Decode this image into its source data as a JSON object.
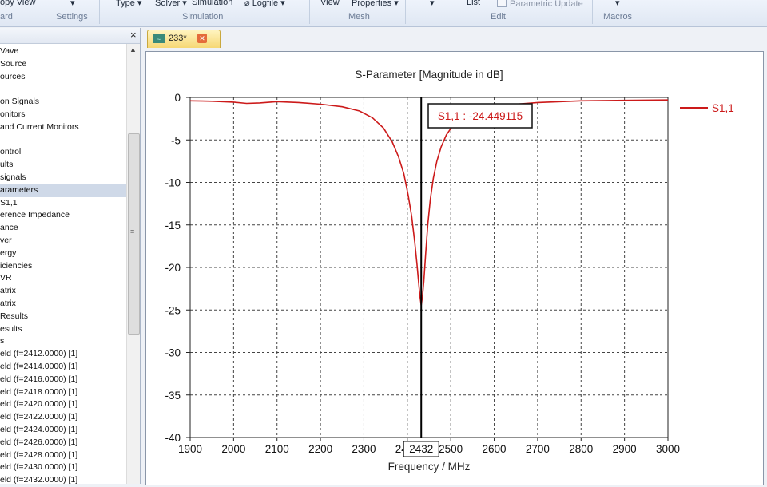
{
  "ribbon": {
    "buttons": [
      "opy View",
      "Type",
      "Solver",
      "Simulation",
      "Logfile",
      "View",
      "Properties",
      "List",
      "Parametric Update"
    ],
    "groups": [
      "ard",
      "Settings",
      "Simulation",
      "Mesh",
      "Edit",
      "Macros"
    ]
  },
  "tree": {
    "items": [
      "Vave",
      "Source",
      "ources",
      "",
      "on Signals",
      "onitors",
      "and Current Monitors",
      "",
      "ontrol",
      "ults",
      "signals",
      "arameters",
      "S1,1",
      "erence Impedance",
      "ance",
      "ver",
      "ergy",
      "iciencies",
      "VR",
      "atrix",
      "atrix",
      "Results",
      "esults",
      "s",
      "eld (f=2412.0000) [1]",
      "eld (f=2414.0000) [1]",
      "eld (f=2416.0000) [1]",
      "eld (f=2418.0000) [1]",
      "eld (f=2420.0000) [1]",
      "eld (f=2422.0000) [1]",
      "eld (f=2424.0000) [1]",
      "eld (f=2426.0000) [1]",
      "eld (f=2428.0000) [1]",
      "eld (f=2430.0000) [1]",
      "eld (f=2432.0000) [1]"
    ],
    "selected_index": 11,
    "close_glyph": "×"
  },
  "document_tab": {
    "label": "233*"
  },
  "chart_data": {
    "type": "line",
    "title": "S-Parameter [Magnitude in dB]",
    "xlabel": "Frequency / MHz",
    "ylabel": "",
    "xlim": [
      1900,
      3000
    ],
    "ylim": [
      -40,
      0
    ],
    "xticks": [
      1900,
      2000,
      2100,
      2200,
      2300,
      2400,
      2500,
      2600,
      2700,
      2800,
      2900,
      3000
    ],
    "yticks": [
      0,
      -5,
      -10,
      -15,
      -20,
      -25,
      -30,
      -35,
      -40
    ],
    "grid": true,
    "legend_position": "right",
    "series": [
      {
        "name": "S1,1",
        "color": "#cc1a1a",
        "x": [
          1900,
          1950,
          2000,
          2030,
          2060,
          2100,
          2150,
          2200,
          2250,
          2290,
          2320,
          2345,
          2365,
          2380,
          2392,
          2402,
          2410,
          2417,
          2422,
          2426,
          2429,
          2432,
          2435,
          2438,
          2442,
          2447,
          2453,
          2460,
          2468,
          2478,
          2490,
          2505,
          2520,
          2540,
          2560,
          2580,
          2600,
          2650,
          2700,
          2800,
          2900,
          3000
        ],
        "y": [
          -0.4,
          -0.45,
          -0.55,
          -0.7,
          -0.65,
          -0.5,
          -0.6,
          -0.8,
          -1.1,
          -1.6,
          -2.4,
          -3.6,
          -5.2,
          -7.0,
          -9.0,
          -11.5,
          -14.0,
          -17.0,
          -19.5,
          -21.8,
          -23.4,
          -24.45,
          -23.4,
          -21.6,
          -18.5,
          -15.0,
          -12.0,
          -9.5,
          -7.5,
          -5.8,
          -4.4,
          -3.3,
          -2.6,
          -2.0,
          -1.6,
          -1.3,
          -1.0,
          -0.8,
          -0.6,
          -0.4,
          -0.35,
          -0.3
        ]
      }
    ],
    "marker": {
      "x": 2432,
      "x_label": "2432",
      "annotation": "S1,1 : -24.449115"
    }
  }
}
